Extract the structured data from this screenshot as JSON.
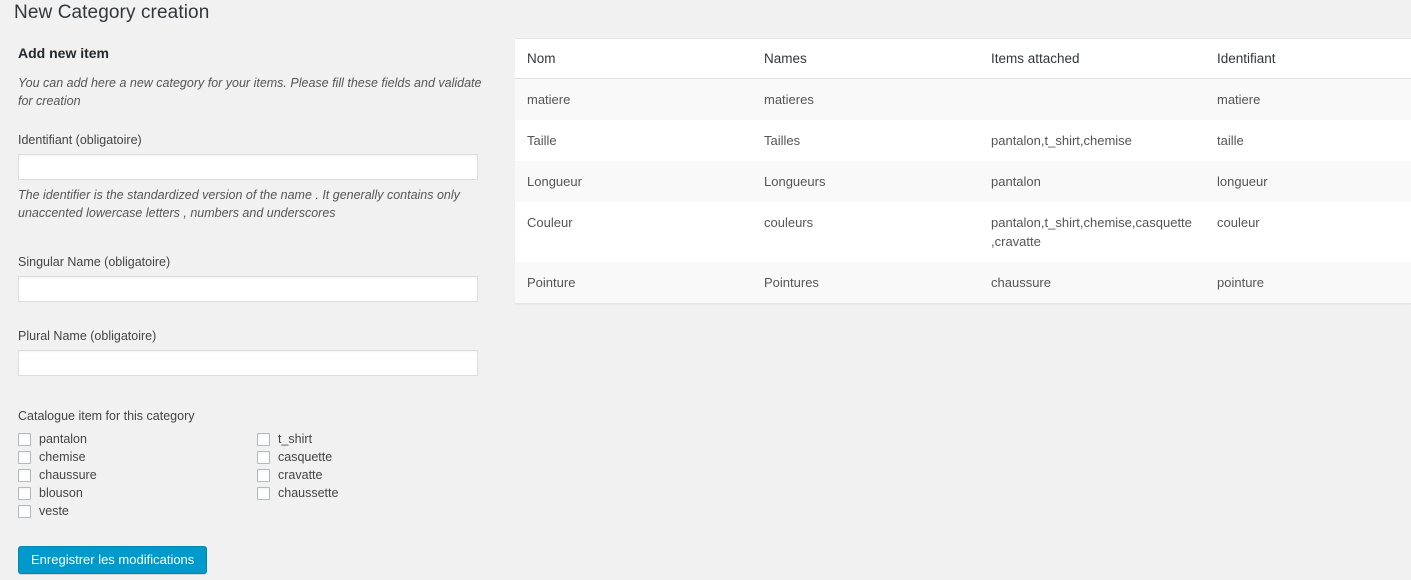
{
  "page": {
    "title": "New Category creation"
  },
  "form": {
    "heading": "Add new item",
    "description": "You can add here a new category for your items. Please fill these fields and validate for creation",
    "identifier": {
      "label": "Identifiant (obligatoire)",
      "value": "",
      "placeholder": "",
      "help": "The identifier is the standardized version of the name . It generally contains only unaccented lowercase letters , numbers and underscores"
    },
    "singular": {
      "label": "Singular Name (obligatoire)",
      "value": "",
      "placeholder": ""
    },
    "plural": {
      "label": "Plural Name (obligatoire)",
      "value": "",
      "placeholder": ""
    },
    "catalogue": {
      "label": "Catalogue item for this category",
      "column_left": [
        {
          "label": "pantalon",
          "checked": false
        },
        {
          "label": "chemise",
          "checked": false
        },
        {
          "label": "chaussure",
          "checked": false
        },
        {
          "label": "blouson",
          "checked": false
        },
        {
          "label": "veste",
          "checked": false
        }
      ],
      "column_right": [
        {
          "label": "t_shirt",
          "checked": false
        },
        {
          "label": "casquette",
          "checked": false
        },
        {
          "label": "cravatte",
          "checked": false
        },
        {
          "label": "chaussette",
          "checked": false
        }
      ]
    },
    "submit_label": "Enregistrer les modifications"
  },
  "table": {
    "headers": [
      "Nom",
      "Names",
      "Items attached",
      "Identifiant"
    ],
    "rows": [
      {
        "nom": "matiere",
        "names": "matieres",
        "items": "",
        "identifiant": "matiere"
      },
      {
        "nom": "Taille",
        "names": "Tailles",
        "items": "pantalon,t_shirt,chemise",
        "identifiant": "taille"
      },
      {
        "nom": "Longueur",
        "names": "Longueurs",
        "items": "pantalon",
        "identifiant": "longueur"
      },
      {
        "nom": "Couleur",
        "names": "couleurs",
        "items": "pantalon,t_shirt,chemise,casquette,cravatte",
        "identifiant": "couleur"
      },
      {
        "nom": "Pointure",
        "names": "Pointures",
        "items": "chaussure",
        "identifiant": "pointure"
      }
    ]
  },
  "colors": {
    "page_background": "#f1f1f1",
    "panel_background": "#ffffff",
    "accent_button": "#0099cc",
    "row_stripe": "#f9f9f9",
    "text": "#444444",
    "heading_text": "#23282d"
  }
}
